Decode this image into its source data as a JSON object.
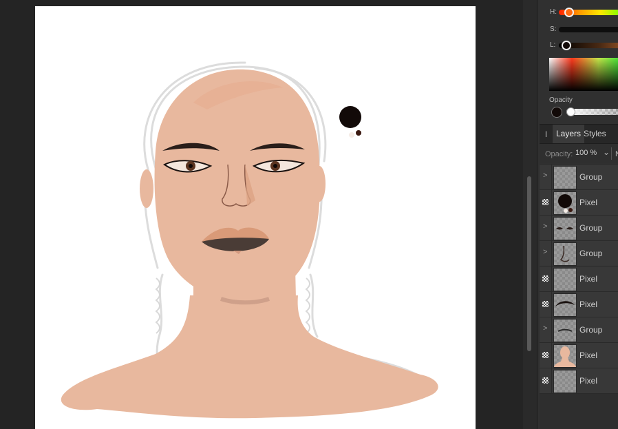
{
  "colors": {
    "canvas_bg": "#242424",
    "panel_bg": "#303030",
    "skin": "#e8b89e",
    "hair_sketch": "#dddddd",
    "brush_color": "#120a08"
  },
  "color_panel": {
    "h_label": "H:",
    "s_label": "S:",
    "l_label": "L:",
    "opacity_label": "Opacity"
  },
  "layers_panel": {
    "tabs": [
      {
        "label": "Layers",
        "active": true
      },
      {
        "label": "Styles",
        "active": false
      }
    ],
    "opacity_label": "Opacity:",
    "opacity_value": "100 %",
    "chevron_icon": "chevron-down-icon",
    "blend_initial": "N",
    "layers": [
      {
        "name": "Group",
        "kind": "group",
        "thumb": "empty"
      },
      {
        "name": "Pixel",
        "kind": "pixel",
        "thumb": "dots"
      },
      {
        "name": "Group",
        "kind": "group",
        "thumb": "eyes"
      },
      {
        "name": "Group",
        "kind": "group",
        "thumb": "nose"
      },
      {
        "name": "Pixel",
        "kind": "pixel",
        "thumb": "empty"
      },
      {
        "name": "Pixel",
        "kind": "pixel",
        "thumb": "brow"
      },
      {
        "name": "Group",
        "kind": "group",
        "thumb": "lip"
      },
      {
        "name": "Pixel",
        "kind": "pixel",
        "thumb": "body"
      },
      {
        "name": "Pixel",
        "kind": "pixel",
        "thumb": "empty"
      }
    ]
  }
}
